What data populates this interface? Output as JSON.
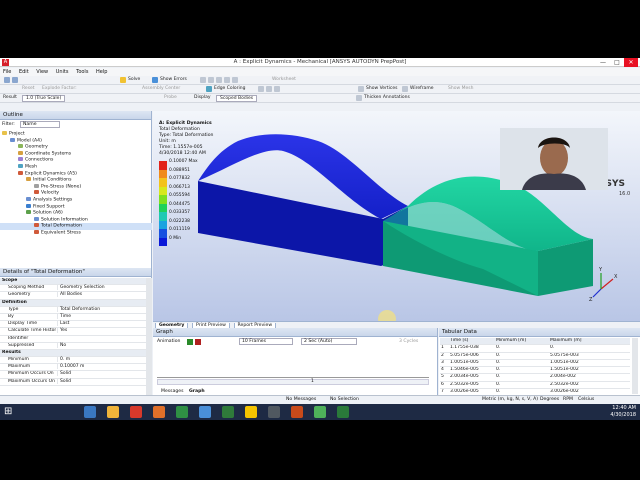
{
  "window": {
    "title": "A : Explicit Dynamics - Mechanical [ANSYS AUTODYN PrepPost]",
    "controls": [
      "—",
      "□",
      "✕"
    ]
  },
  "menu": [
    "File",
    "Edit",
    "View",
    "Units",
    "Tools",
    "Help"
  ],
  "toolbar1": {
    "solve": "Solve",
    "show_errors": "Show Errors",
    "worksheet": "Worksheet"
  },
  "toolbar2": {
    "reset": "Reset",
    "explode_factor": "Explode Factor:",
    "assembly_center": "Assembly Center",
    "edge_coloring": "Edge Coloring",
    "show_vertices": "Show Vertices",
    "wireframe": "Wireframe",
    "show_mesh": "Show Mesh"
  },
  "toolbar3": {
    "result_label": "Result",
    "result_scale": "1.0 (True Scale)",
    "probe": "Probe",
    "display": "Display",
    "scoped_bodies": "Scoped Bodies",
    "thicken_annotations": "Thicken Annotations"
  },
  "outline": {
    "title": "Outline",
    "filter_label": "Filter:",
    "filter_value": "Name",
    "tree": [
      {
        "label": "Project",
        "indent": 0,
        "color": "#e8c24a"
      },
      {
        "label": "Model (A4)",
        "indent": 1,
        "color": "#6a8fd1"
      },
      {
        "label": "Geometry",
        "indent": 2,
        "color": "#8bb55a"
      },
      {
        "label": "Coordinate Systems",
        "indent": 2,
        "color": "#d6a040"
      },
      {
        "label": "Connections",
        "indent": 2,
        "color": "#9b7fd3"
      },
      {
        "label": "Mesh",
        "indent": 2,
        "color": "#4fa3c2"
      },
      {
        "label": "Explicit Dynamics (A5)",
        "indent": 2,
        "color": "#d05a3a"
      },
      {
        "label": "Initial Conditions",
        "indent": 3,
        "color": "#d6a040"
      },
      {
        "label": "Pre-Stress (None)",
        "indent": 4,
        "color": "#a0a0a0"
      },
      {
        "label": "Velocity",
        "indent": 4,
        "color": "#d05a3a"
      },
      {
        "label": "Analysis Settings",
        "indent": 3,
        "color": "#6a8fd1"
      },
      {
        "label": "Fixed Support",
        "indent": 3,
        "color": "#3a7fd0"
      },
      {
        "label": "Solution (A6)",
        "indent": 3,
        "color": "#5ca04a"
      },
      {
        "label": "Solution Information",
        "indent": 4,
        "color": "#6a8fd1"
      },
      {
        "label": "Total Deformation",
        "indent": 4,
        "color": "#d05a3a"
      },
      {
        "label": "Equivalent Stress",
        "indent": 4,
        "color": "#d05a3a"
      }
    ]
  },
  "details": {
    "title": "Details of \"Total Deformation\"",
    "rows": [
      {
        "section": true,
        "k": "Scope",
        "v": ""
      },
      {
        "k": "Scoping Method",
        "v": "Geometry Selection"
      },
      {
        "k": "Geometry",
        "v": "All Bodies"
      },
      {
        "section": true,
        "k": "Definition",
        "v": ""
      },
      {
        "k": "Type",
        "v": "Total Deformation"
      },
      {
        "k": "By",
        "v": "Time"
      },
      {
        "k": "Display Time",
        "v": "Last"
      },
      {
        "k": "Calculate Time History",
        "v": "Yes"
      },
      {
        "k": "Identifier",
        "v": ""
      },
      {
        "k": "Suppressed",
        "v": "No"
      },
      {
        "section": true,
        "k": "Results",
        "v": ""
      },
      {
        "k": "Minimum",
        "v": "0. m"
      },
      {
        "k": "Maximum",
        "v": "0.10007 m"
      },
      {
        "k": "Minimum Occurs On",
        "v": "Solid"
      },
      {
        "k": "Maximum Occurs On",
        "v": "Solid"
      }
    ]
  },
  "viewport": {
    "info": [
      "A: Explicit Dynamics",
      "Total Deformation",
      "Type: Total Deformation",
      "Unit: m",
      "Time: 1.1557e-005",
      "4/30/2018 12:40 AM"
    ],
    "legend": [
      {
        "label": "0.10007 Max",
        "color": "#e2231a"
      },
      {
        "label": "0.088951",
        "color": "#f08a1a"
      },
      {
        "label": "0.077832",
        "color": "#f3c21b"
      },
      {
        "label": "0.066713",
        "color": "#d7e81c"
      },
      {
        "label": "0.055594",
        "color": "#7fe01e"
      },
      {
        "label": "0.044475",
        "color": "#1fd15a"
      },
      {
        "label": "0.033357",
        "color": "#1fc9b3"
      },
      {
        "label": "0.022238",
        "color": "#1aa3e0"
      },
      {
        "label": "0.011119",
        "color": "#1650e0"
      },
      {
        "label": "0 Min",
        "color": "#0a18d8"
      }
    ],
    "logo": "ANSYS",
    "version": "16.0",
    "tabs": [
      "Geometry",
      "Print Preview",
      "Report Preview"
    ]
  },
  "graph": {
    "title": "Graph",
    "animation_label": "Animation",
    "frames": "10 Frames",
    "duration": "2 Sec (Auto)",
    "cycles": "3 Cycles",
    "bar_value": "1",
    "bottom_tabs": [
      "Messages",
      "Graph"
    ]
  },
  "tabular": {
    "title": "Tabular Data",
    "headers": [
      "Time [s]",
      "Minimum [m]",
      "Maximum [m]"
    ],
    "rows": [
      [
        "1",
        "1.1755e-038",
        "0.",
        "0."
      ],
      [
        "2",
        "5.0575e-006",
        "0.",
        "5.0575e-003"
      ],
      [
        "3",
        "1.0051e-005",
        "0.",
        "1.0051e-002"
      ],
      [
        "4",
        "1.5046e-005",
        "0.",
        "1.5051e-002"
      ],
      [
        "5",
        "2.0034e-005",
        "0.",
        "2.004e-002"
      ],
      [
        "6",
        "2.5032e-005",
        "0.",
        "2.5032e-002"
      ],
      [
        "7",
        "3.0026e-005",
        "0.",
        "3.0026e-002"
      ]
    ]
  },
  "status": {
    "messages": "No Messages",
    "selection": "No Selection",
    "units": "Metric (m, kg, N, s, V, A)",
    "angle": "Degrees",
    "rpm": "RPM",
    "temp": "Celsius"
  },
  "taskbar": {
    "time": "12:40 AM",
    "date": "4/30/2018",
    "apps": [
      "#3a78c2",
      "#f0b43a",
      "#d8392b",
      "#e0702a",
      "#2f8f44",
      "#4a8fd8",
      "#2f7a3a",
      "#f5c400",
      "#505860",
      "#c84a1a",
      "#4fb05a",
      "#2a7a3a"
    ]
  }
}
